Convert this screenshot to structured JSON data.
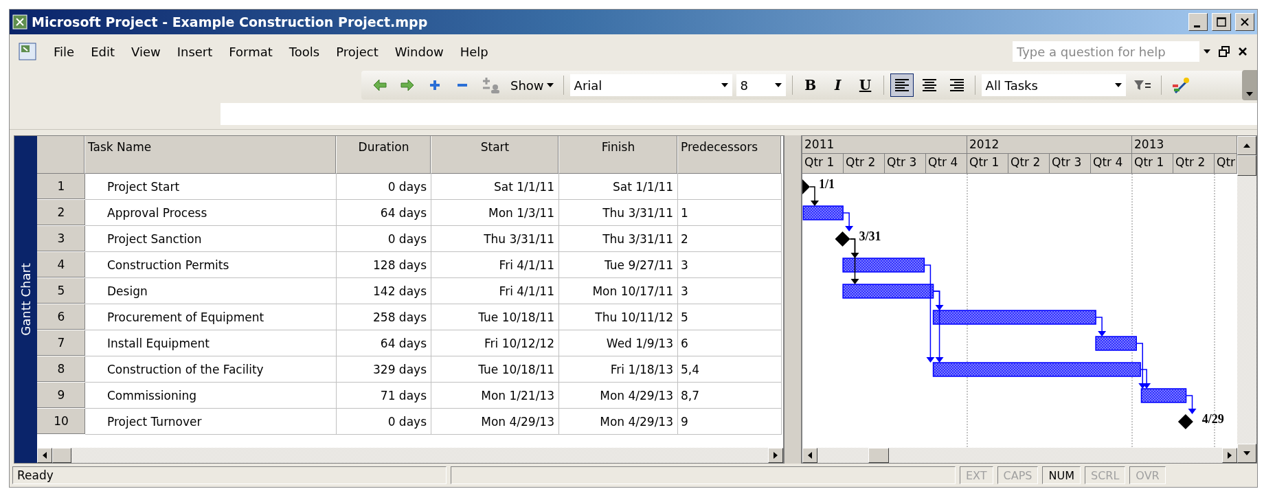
{
  "window": {
    "title": "Microsoft Project - Example Construction Project.mpp"
  },
  "menu": [
    "File",
    "Edit",
    "View",
    "Insert",
    "Format",
    "Tools",
    "Project",
    "Window",
    "Help"
  ],
  "help_box": {
    "placeholder": "Type a question for help"
  },
  "toolbar": {
    "show_label": "Show",
    "font": "Arial",
    "font_size": "8",
    "bold": "B",
    "italic": "I",
    "underline": "U",
    "align": [
      {
        "kind": "left",
        "selected": true
      },
      {
        "kind": "center",
        "selected": false
      },
      {
        "kind": "right",
        "selected": false
      }
    ],
    "filter": "All Tasks"
  },
  "view_bar": {
    "label": "Gantt Chart"
  },
  "table": {
    "columns": [
      "Task Name",
      "Duration",
      "Start",
      "Finish",
      "Predecessors"
    ],
    "rows": [
      {
        "id": "1",
        "kind": "milestone",
        "name": "Project Start",
        "duration": "0 days",
        "start": "Sat 1/1/11",
        "finish": "Sat 1/1/11",
        "predecessors": "",
        "label": "1/1"
      },
      {
        "id": "2",
        "kind": "task",
        "name": "Approval Process",
        "duration": "64 days",
        "start": "Mon 1/3/11",
        "finish": "Thu 3/31/11",
        "predecessors": "1"
      },
      {
        "id": "3",
        "kind": "milestone",
        "name": "Project Sanction",
        "duration": "0 days",
        "start": "Thu 3/31/11",
        "finish": "Thu 3/31/11",
        "predecessors": "2",
        "label": "3/31"
      },
      {
        "id": "4",
        "kind": "task",
        "name": "Construction Permits",
        "duration": "128 days",
        "start": "Fri 4/1/11",
        "finish": "Tue 9/27/11",
        "predecessors": "3"
      },
      {
        "id": "5",
        "kind": "task",
        "name": "Design",
        "duration": "142 days",
        "start": "Fri 4/1/11",
        "finish": "Mon 10/17/11",
        "predecessors": "3"
      },
      {
        "id": "6",
        "kind": "task",
        "name": "Procurement of Equipment",
        "duration": "258 days",
        "start": "Tue 10/18/11",
        "finish": "Thu 10/11/12",
        "predecessors": "5"
      },
      {
        "id": "7",
        "kind": "task",
        "name": "Install Equipment",
        "duration": "64 days",
        "start": "Fri 10/12/12",
        "finish": "Wed 1/9/13",
        "predecessors": "6"
      },
      {
        "id": "8",
        "kind": "task",
        "name": "Construction of the Facility",
        "duration": "329 days",
        "start": "Tue 10/18/11",
        "finish": "Fri 1/18/13",
        "predecessors": "5,4"
      },
      {
        "id": "9",
        "kind": "task",
        "name": "Commissioning",
        "duration": "71 days",
        "start": "Mon 1/21/13",
        "finish": "Mon 4/29/13",
        "predecessors": "8,7"
      },
      {
        "id": "10",
        "kind": "milestone",
        "name": "Project Turnover",
        "duration": "0 days",
        "start": "Mon 4/29/13",
        "finish": "Mon 4/29/13",
        "predecessors": "9",
        "label": "4/29"
      }
    ]
  },
  "timescale": {
    "years": [
      "2011",
      "2012",
      "2013"
    ],
    "quarters": [
      "Qtr 1",
      "Qtr 2",
      "Qtr 3",
      "Qtr 4",
      "Qtr 1",
      "Qtr 2",
      "Qtr 3",
      "Qtr 4",
      "Qtr 1",
      "Qtr 2",
      "Qtr"
    ]
  },
  "status_bar": {
    "text": "Ready",
    "indicators": [
      {
        "label": "EXT",
        "on": false
      },
      {
        "label": "CAPS",
        "on": false
      },
      {
        "label": "NUM",
        "on": true
      },
      {
        "label": "SCRL",
        "on": false
      },
      {
        "label": "OVR",
        "on": false
      }
    ]
  }
}
